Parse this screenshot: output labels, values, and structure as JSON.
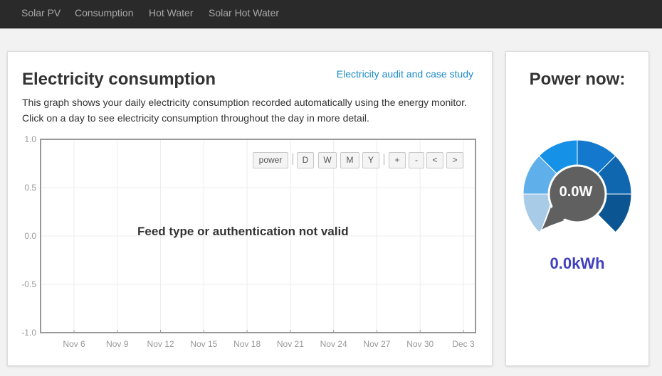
{
  "nav": {
    "items": [
      {
        "label": "Solar PV"
      },
      {
        "label": "Consumption"
      },
      {
        "label": "Hot Water"
      },
      {
        "label": "Solar Hot Water"
      }
    ]
  },
  "main": {
    "title": "Electricity consumption",
    "audit_link": "Electricity audit and case study",
    "description_line1": "This graph shows your daily electricity consumption recorded automatically using the energy monitor.",
    "description_line2": "Click on a day to see electricity consumption throughout the day in more detail.",
    "controls": {
      "power": "power",
      "day": "D",
      "week": "W",
      "month": "M",
      "year": "Y",
      "zoom_in": "+",
      "zoom_out": "-",
      "prev": "<",
      "next": ">"
    },
    "error_message": "Feed type or authentication not valid"
  },
  "chart_data": {
    "type": "line",
    "title": "",
    "xlabel": "",
    "ylabel": "",
    "series": [],
    "y_ticks": [
      "1.0",
      "0.5",
      "0.0",
      "-0.5",
      "-1.0"
    ],
    "x_ticks": [
      "Nov 6",
      "Nov 9",
      "Nov 12",
      "Nov 15",
      "Nov 18",
      "Nov 21",
      "Nov 24",
      "Nov 27",
      "Nov 30",
      "Dec 3"
    ],
    "ylim": [
      -1.0,
      1.0
    ],
    "grid": true
  },
  "side": {
    "title": "Power now:",
    "power_value": "0.0W",
    "energy_value": "0.0kWh",
    "gauge_level": 0.0,
    "gauge_colors": [
      "#a8cbe8",
      "#5fb0ea",
      "#1591e8",
      "#1479cc",
      "#0f67b0",
      "#0b5592"
    ]
  }
}
